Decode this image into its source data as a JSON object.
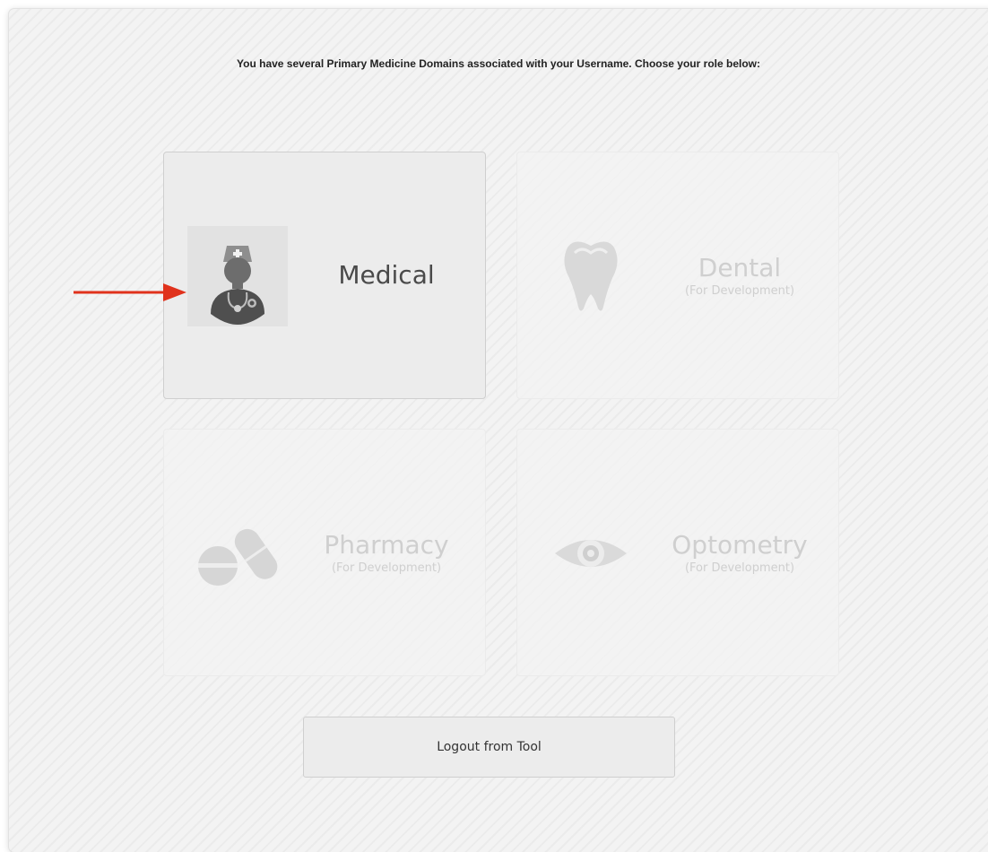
{
  "instruction": "You have several Primary Medicine Domains associated with your Username. Choose your role below:",
  "roles": [
    {
      "title": "Medical",
      "subtitle": "",
      "icon": "doctor-nurse-icon",
      "state": "active"
    },
    {
      "title": "Dental",
      "subtitle": "(For Development)",
      "icon": "tooth-icon",
      "state": "disabled"
    },
    {
      "title": "Pharmacy",
      "subtitle": "(For Development)",
      "icon": "pills-icon",
      "state": "disabled"
    },
    {
      "title": "Optometry",
      "subtitle": "(For Development)",
      "icon": "eye-icon",
      "state": "disabled"
    }
  ],
  "logout_label": "Logout from Tool",
  "colors": {
    "arrow": "#e0321c",
    "active_text": "#4a4a4a",
    "disabled_text": "#cfcfcf",
    "card_active_bg": "#ececec"
  }
}
